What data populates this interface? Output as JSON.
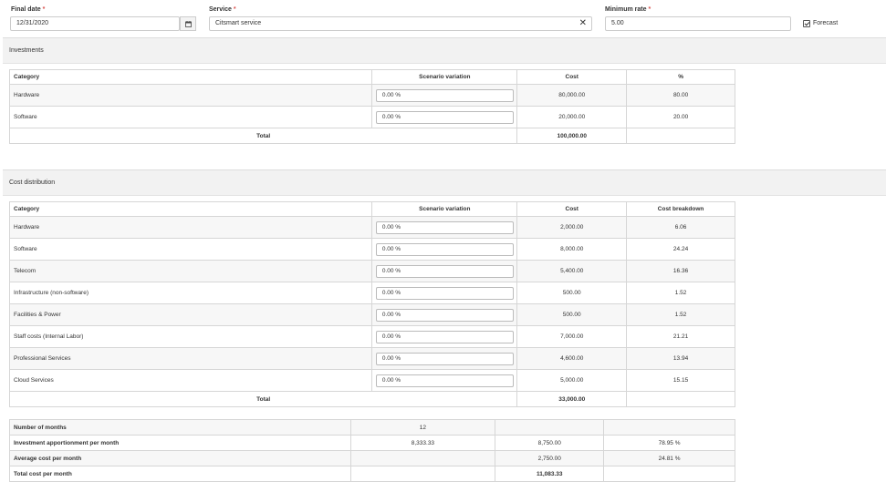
{
  "filters": {
    "final_date": {
      "label": "Final date",
      "value": "12/31/2020"
    },
    "service": {
      "label": "Service",
      "value": "Citsmart service"
    },
    "minimum_rate": {
      "label": "Minimum rate",
      "value": "5.00"
    },
    "forecast": {
      "label": "Forecast",
      "checked": true
    },
    "required_mark": "*"
  },
  "investments": {
    "title": "Investments",
    "headers": [
      "Category",
      "Scenario variation",
      "Cost",
      "%"
    ],
    "rows": [
      {
        "category": "Hardware",
        "variation": "0.00 %",
        "cost": "80,000.00",
        "pct": "80.00"
      },
      {
        "category": "Software",
        "variation": "0.00 %",
        "cost": "20,000.00",
        "pct": "20.00"
      }
    ],
    "total_label": "Total",
    "total_cost": "100,000.00"
  },
  "cost_distribution": {
    "title": "Cost distribution",
    "headers": [
      "Category",
      "Scenario variation",
      "Cost",
      "Cost breakdown"
    ],
    "rows": [
      {
        "category": "Hardware",
        "variation": "0.00 %",
        "cost": "2,000.00",
        "breakdown": "6.06"
      },
      {
        "category": "Software",
        "variation": "0.00 %",
        "cost": "8,000.00",
        "breakdown": "24.24"
      },
      {
        "category": "Telecom",
        "variation": "0.00 %",
        "cost": "5,400.00",
        "breakdown": "16.36"
      },
      {
        "category": "Infrastructure (non-software)",
        "variation": "0.00 %",
        "cost": "500.00",
        "breakdown": "1.52"
      },
      {
        "category": "Facilities & Power",
        "variation": "0.00 %",
        "cost": "500.00",
        "breakdown": "1.52"
      },
      {
        "category": "Staff costs (Internal Labor)",
        "variation": "0.00 %",
        "cost": "7,000.00",
        "breakdown": "21.21"
      },
      {
        "category": "Professional Services",
        "variation": "0.00 %",
        "cost": "4,600.00",
        "breakdown": "13.94"
      },
      {
        "category": "Cloud Services",
        "variation": "0.00 %",
        "cost": "5,000.00",
        "breakdown": "15.15"
      }
    ],
    "total_label": "Total",
    "total_cost": "33,000.00"
  },
  "summary": {
    "rows": [
      {
        "label": "Number of months",
        "c1": "12",
        "c2": "",
        "c3": ""
      },
      {
        "label": "Investment apportionment per month",
        "c1": "8,333.33",
        "c2": "8,750.00",
        "c3": "78.95 %"
      },
      {
        "label": "Average cost per month",
        "c1": "",
        "c2": "2,750.00",
        "c3": "24.81 %"
      },
      {
        "label": "Total cost per month",
        "c1": "",
        "c2": "11,083.33",
        "c3": ""
      }
    ]
  }
}
